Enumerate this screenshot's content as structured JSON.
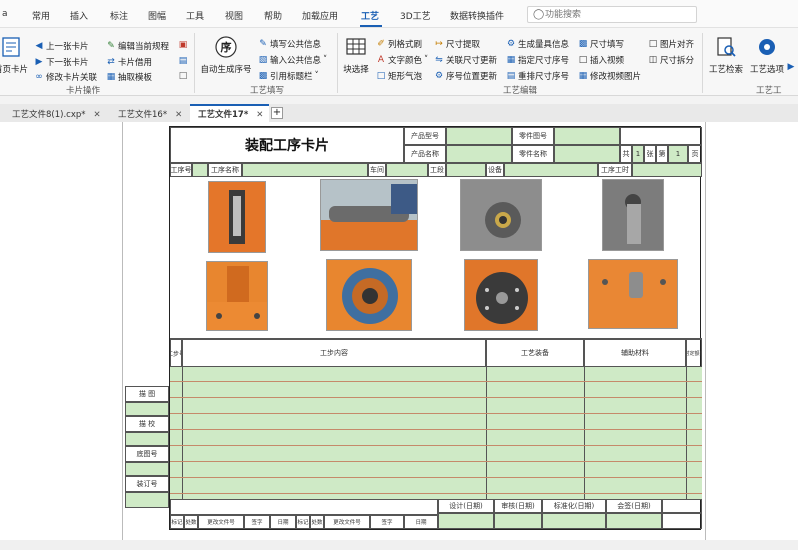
{
  "menu": {
    "items": [
      "a",
      "常用",
      "插入",
      "标注",
      "图幅",
      "工具",
      "视图",
      "帮助",
      "加载应用",
      "工艺",
      "3D工艺",
      "数据转换插件"
    ],
    "active": "工艺",
    "search_placeholder": "功能搜索"
  },
  "ribbon": {
    "card_ops": {
      "first_card_label": "首页卡片",
      "prev_card": "上一张卡片",
      "next_card": "下一张卡片",
      "modify_card_link": "修改卡片关联",
      "edit_current_rule": "编辑当前规程",
      "card_borrow": "卡片借用",
      "extract_template": "抽取模板",
      "group_label": "卡片操作"
    },
    "fill": {
      "auto_seq": "自动生成序号",
      "seq_glyph": "序",
      "fill_public": "填写公共信息",
      "input_public": "输入公共信息",
      "ref_title": "引用标题栏",
      "group_label": "工艺填写"
    },
    "edit": {
      "block_select": "块选择",
      "column_format": "列格式刷",
      "text_color": "文字颜色",
      "rect_bubble": "矩形气泡",
      "dim_extract": "尺寸提取",
      "link_dim_update": "关联尺寸更新",
      "seq_pos_update": "序号位置更新",
      "gen_tool_info": "生成量具信息",
      "assign_dim_seq": "指定尺寸序号",
      "reorder_dim_seq": "重排尺寸序号",
      "dim_fill": "尺寸填写",
      "insert_video": "插入视频",
      "modify_video_pic": "修改视频图片",
      "pic_align": "图片对齐",
      "dim_split": "尺寸拆分",
      "group_label": "工艺编辑"
    },
    "tools": {
      "process_search": "工艺检索",
      "process_options": "工艺选项",
      "group_label": "工艺工"
    }
  },
  "tabs": [
    {
      "label": "工艺文件8(1).cxp*",
      "active": false
    },
    {
      "label": "工艺文件16*",
      "active": false
    },
    {
      "label": "工艺文件17*",
      "active": true
    }
  ],
  "card": {
    "title": "装配工序卡片",
    "product_code": "产品型号",
    "product_name": "产品名称",
    "part_code": "零件图号",
    "part_name": "零件名称",
    "total": "共",
    "sheet_count": "1",
    "sheet_word": "张",
    "page_word": "第",
    "page_num": "1",
    "page_unit": "页",
    "process_no": "工序号",
    "process_name": "工序名称",
    "workshop": "车间",
    "section": "工段",
    "equipment": "设备",
    "process_hours": "工序工时",
    "step_no": "工步号",
    "step_content": "工步内容",
    "process_equip": "工艺装备",
    "aux_material": "辅助材料",
    "step_hours": "工时定额(分)",
    "side_labels": [
      "描 图",
      "描 校",
      "底图号",
      "装订号"
    ],
    "sign_labels": [
      "设计(日期)",
      "审核(日期)",
      "标准化(日期)",
      "会签(日期)"
    ],
    "revision_labels": [
      "标记",
      "处数",
      "更改文件号",
      "签字",
      "日期",
      "标记",
      "处数",
      "更改文件号",
      "签字",
      "日期"
    ]
  },
  "colors": {
    "accent": "#1a5fb4",
    "cell_green": "#cfeac6",
    "row_line": "#c58a6a"
  }
}
